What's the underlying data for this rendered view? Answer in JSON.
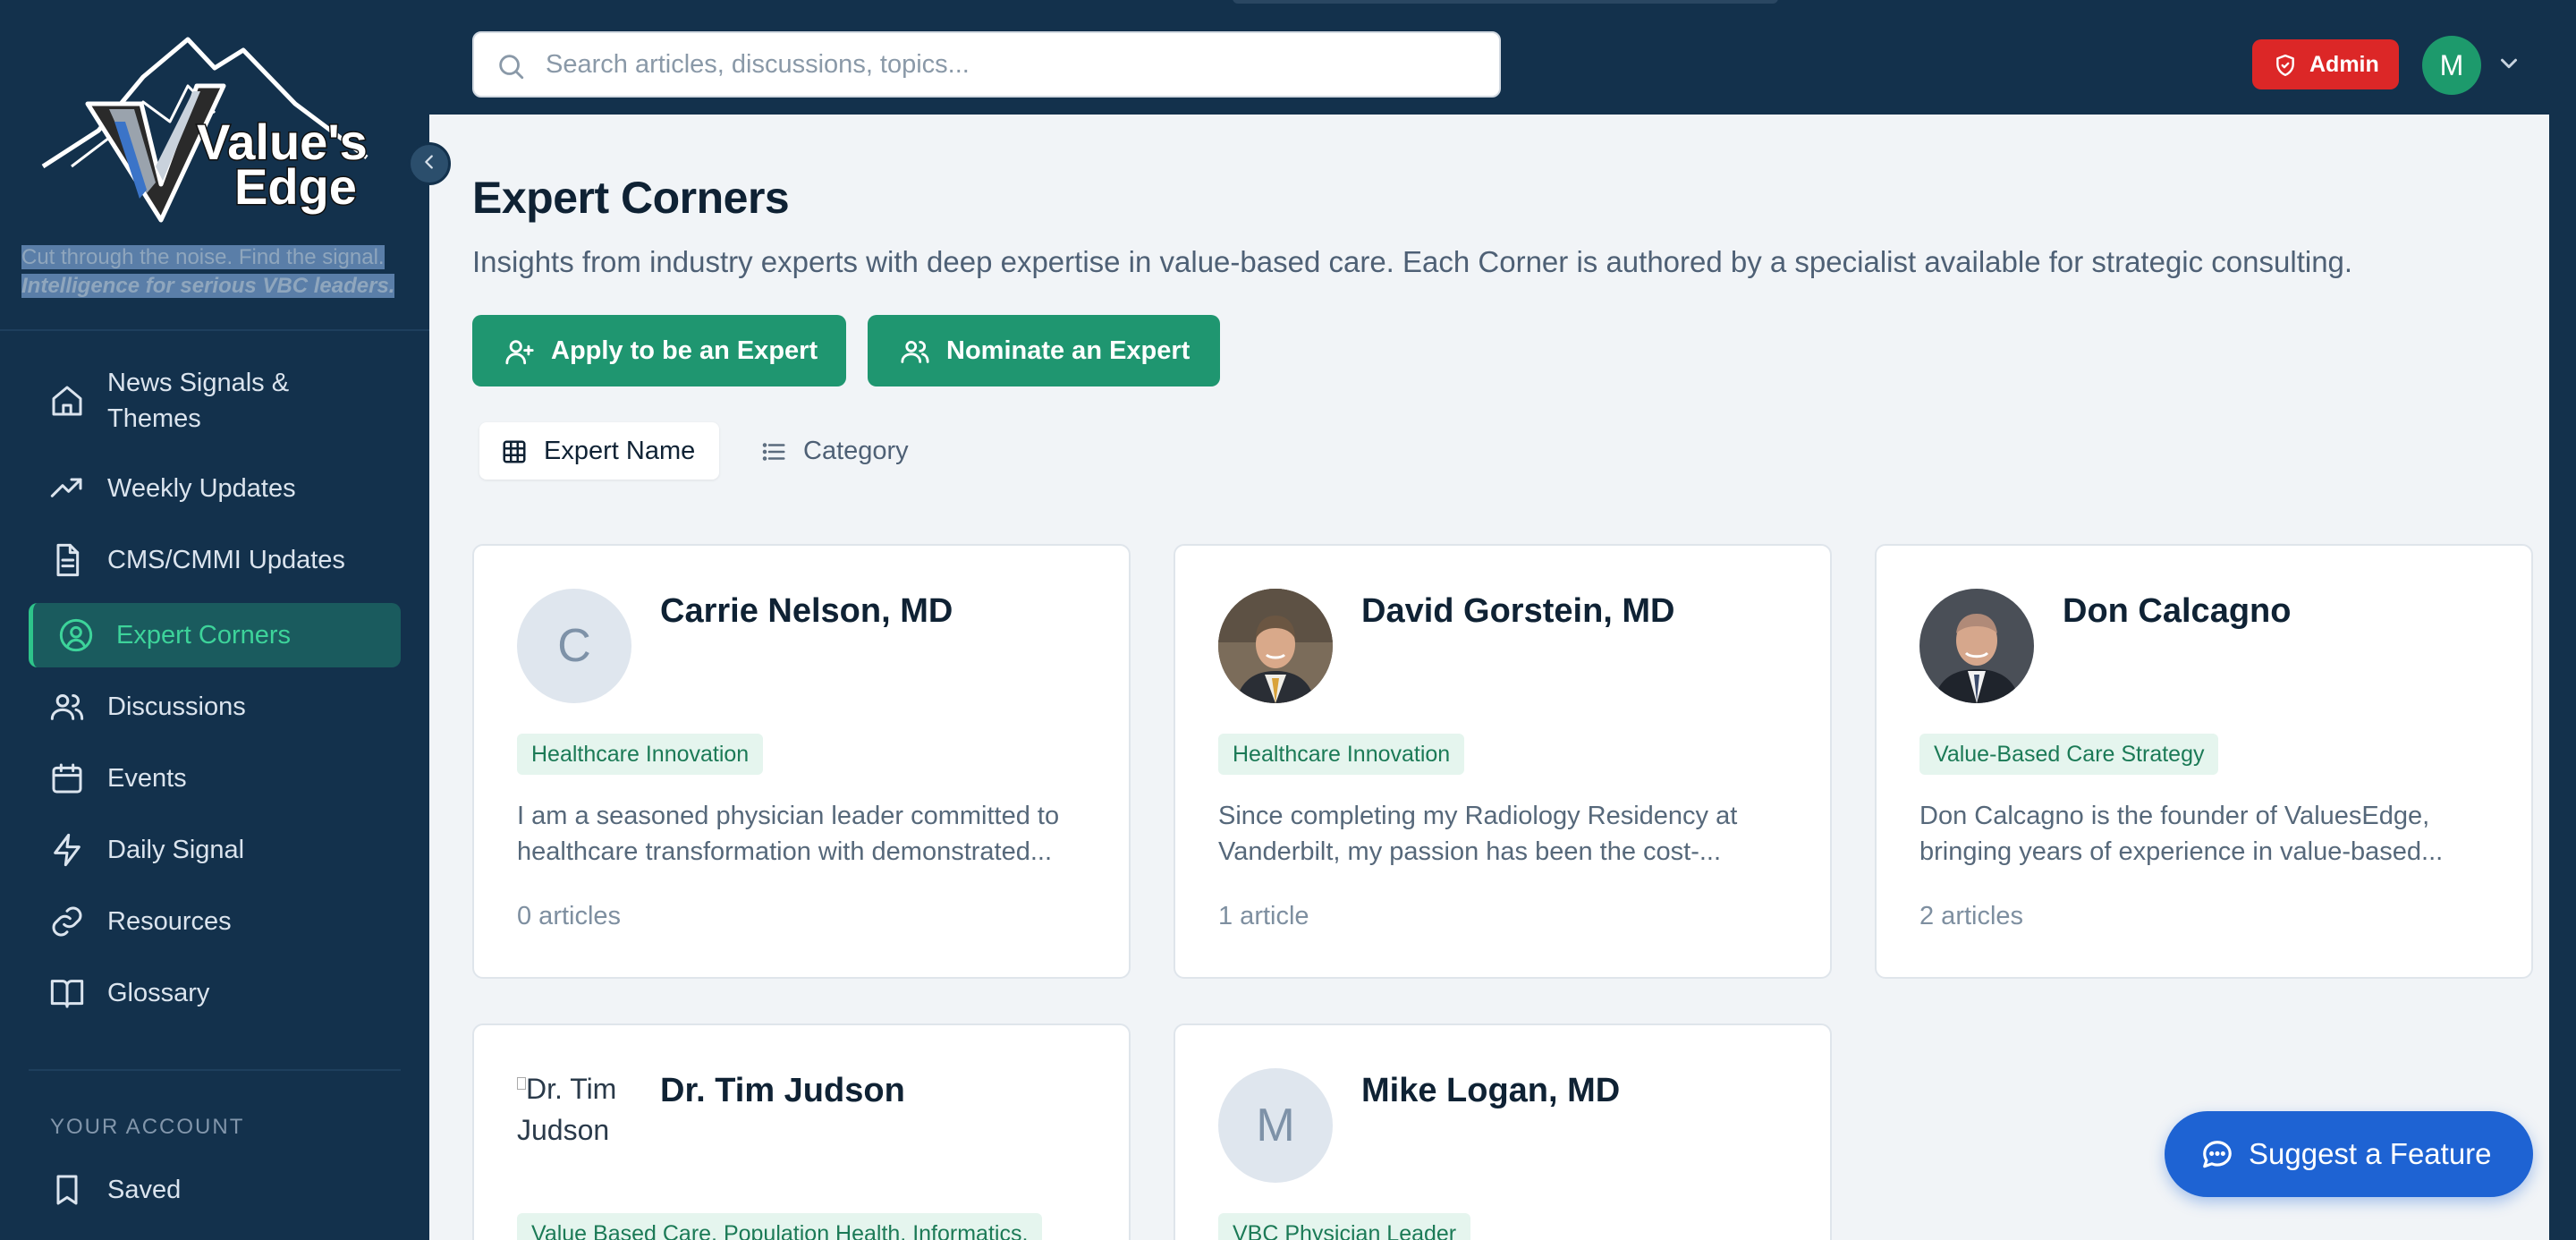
{
  "brand": {
    "logo_text_line1": "Value's",
    "logo_text_line2": "Edge",
    "tagline_line1": "Cut through the noise. Find the signal.",
    "tagline_line2": "Intelligence for serious VBC leaders."
  },
  "sidebar": {
    "items": [
      {
        "label_line1": "News Signals &",
        "label_line2": "Themes",
        "icon": "home-icon"
      },
      {
        "label": "Weekly Updates",
        "icon": "trending-up-icon"
      },
      {
        "label": "CMS/CMMI Updates",
        "icon": "document-icon"
      },
      {
        "label": "Expert Corners",
        "icon": "user-circle-icon",
        "active": true
      },
      {
        "label": "Discussions",
        "icon": "users-icon"
      },
      {
        "label": "Events",
        "icon": "calendar-icon"
      },
      {
        "label": "Daily Signal",
        "icon": "bolt-icon"
      },
      {
        "label": "Resources",
        "icon": "link-icon"
      },
      {
        "label": "Glossary",
        "icon": "book-icon"
      }
    ],
    "section_label": "YOUR ACCOUNT",
    "account_items": [
      {
        "label": "Saved",
        "icon": "bookmark-icon"
      }
    ]
  },
  "header": {
    "search_placeholder": "Search articles, discussions, topics...",
    "admin_label": "Admin",
    "avatar_initial": "M"
  },
  "main": {
    "title": "Expert Corners",
    "subtitle": "Insights from industry experts with deep expertise in value-based care. Each Corner is authored by a specialist available for strategic consulting.",
    "apply_button": "Apply to be an Expert",
    "nominate_button": "Nominate an Expert",
    "view_tabs": [
      {
        "label": "Expert Name",
        "selected": true
      },
      {
        "label": "Category",
        "selected": false
      }
    ],
    "experts": [
      {
        "initial": "C",
        "name": "Carrie Nelson, MD",
        "category": "Healthcare Innovation",
        "desc_line1": "I am a seasoned physician leader committed to",
        "desc_line2": "healthcare transformation with demonstrated...",
        "articles": "0 articles"
      },
      {
        "name": "David Gorstein, MD",
        "category": "Healthcare Innovation",
        "desc_line1": "Since completing my Radiology Residency at",
        "desc_line2": "Vanderbilt, my passion has been the cost-...",
        "articles": "1 article"
      },
      {
        "name": "Don Calcagno",
        "category": "Value-Based Care Strategy",
        "desc_line1": "Don Calcagno is the founder of ValuesEdge,",
        "desc_line2": "bringing years of experience in value-based...",
        "articles": "2 articles"
      },
      {
        "alt_text": "Dr. Tim Judson",
        "name": "Dr. Tim Judson",
        "category": "Value Based Care, Population Health, Informatics,"
      },
      {
        "initial": "M",
        "name": "Mike Logan, MD",
        "category": "VBC Physician Leader"
      }
    ]
  },
  "suggest_button": "Suggest a Feature",
  "colors": {
    "sidebar_bg": "#13314c",
    "accent_green": "#1f9670",
    "admin_red": "#dc2727",
    "suggest_blue": "#1e63d3"
  }
}
